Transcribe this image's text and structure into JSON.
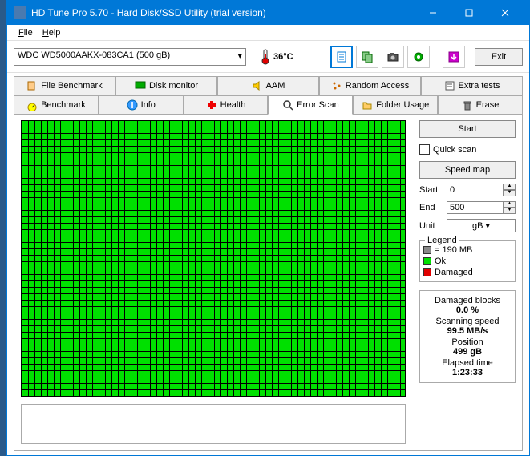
{
  "window": {
    "title": "HD Tune Pro 5.70 - Hard Disk/SSD Utility (trial version)"
  },
  "menu": {
    "file": "File",
    "help": "Help"
  },
  "toolbar": {
    "drive": "WDC WD5000AAKX-083CA1 (500 gB)",
    "temperature": "36°C",
    "exit": "Exit"
  },
  "tabs_top": [
    {
      "label": "File Benchmark"
    },
    {
      "label": "Disk monitor"
    },
    {
      "label": "AAM"
    },
    {
      "label": "Random Access"
    },
    {
      "label": "Extra tests"
    }
  ],
  "tabs_bottom": [
    {
      "label": "Benchmark"
    },
    {
      "label": "Info"
    },
    {
      "label": "Health"
    },
    {
      "label": "Error Scan"
    },
    {
      "label": "Folder Usage"
    },
    {
      "label": "Erase"
    }
  ],
  "controls": {
    "start": "Start",
    "quick_scan": "Quick scan",
    "speed_map": "Speed map",
    "start_label": "Start",
    "start_val": "0",
    "end_label": "End",
    "end_val": "500",
    "unit_label": "Unit",
    "unit_val": "gB"
  },
  "legend": {
    "title": "Legend",
    "size": "= 190 MB",
    "ok": "Ok",
    "damaged": "Damaged",
    "colors": {
      "size": "#888888",
      "ok": "#00e000",
      "damaged": "#e00000"
    }
  },
  "stats": {
    "damaged_label": "Damaged blocks",
    "damaged_val": "0.0 %",
    "speed_label": "Scanning speed",
    "speed_val": "99.5 MB/s",
    "position_label": "Position",
    "position_val": "499 gB",
    "elapsed_label": "Elapsed time",
    "elapsed_val": "1:23:33"
  }
}
